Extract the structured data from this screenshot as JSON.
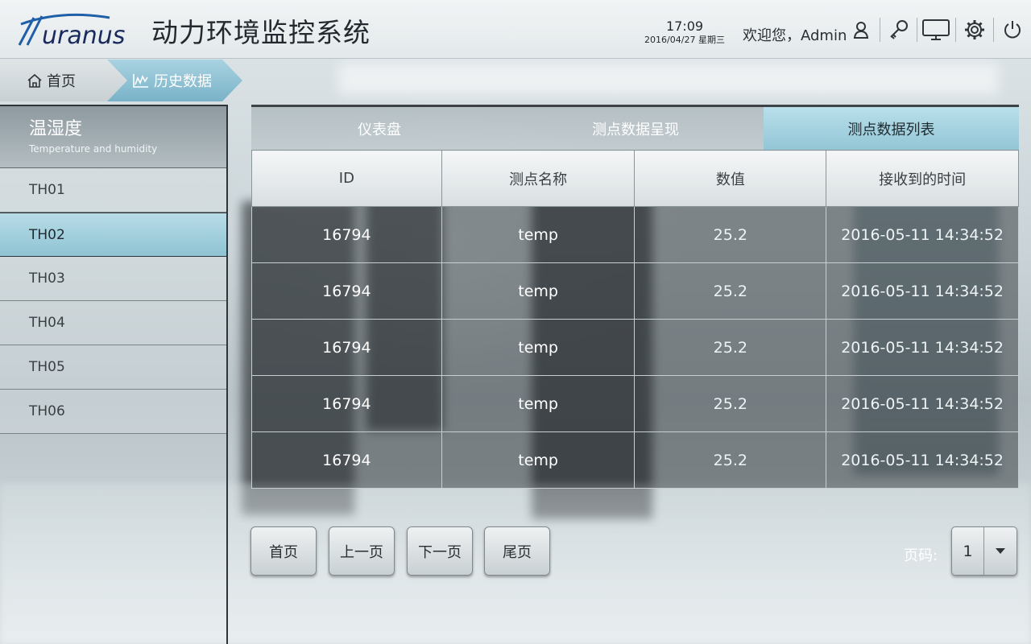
{
  "brand": {
    "logo_text": "uranus",
    "title": "动力环境监控系统"
  },
  "header": {
    "time": "17:09",
    "date": "2016/04/27 星期三",
    "welcome": "欢迎您，Admin",
    "icons": [
      "user-icon",
      "key-icon",
      "monitor-icon",
      "gear-icon",
      "power-icon"
    ]
  },
  "breadcrumb": {
    "home": "首页",
    "current": "历史数据"
  },
  "sidebar": {
    "title": "温湿度",
    "subtitle": "Temperature and humidity",
    "items": [
      "TH01",
      "TH02",
      "TH03",
      "TH04",
      "TH05",
      "TH06"
    ],
    "active_index": 1
  },
  "tabs": [
    "仪表盘",
    "测点数据呈现",
    "测点数据列表"
  ],
  "active_tab": 2,
  "table": {
    "headers": [
      "ID",
      "测点名称",
      "数值",
      "接收到的时间"
    ],
    "rows": [
      [
        "16794",
        "temp",
        "25.2",
        "2016-05-11 14:34:52"
      ],
      [
        "16794",
        "temp",
        "25.2",
        "2016-05-11 14:34:52"
      ],
      [
        "16794",
        "temp",
        "25.2",
        "2016-05-11 14:34:52"
      ],
      [
        "16794",
        "temp",
        "25.2",
        "2016-05-11 14:34:52"
      ],
      [
        "16794",
        "temp",
        "25.2",
        "2016-05-11 14:34:52"
      ]
    ]
  },
  "pagination": {
    "first": "首页",
    "prev": "上一页",
    "next": "下一页",
    "last": "尾页",
    "page_label": "页码:",
    "page_value": "1"
  },
  "colors": {
    "accent": "#8fc3d3",
    "header_bg": "#e8edef",
    "row_bg": "#3c4246"
  }
}
